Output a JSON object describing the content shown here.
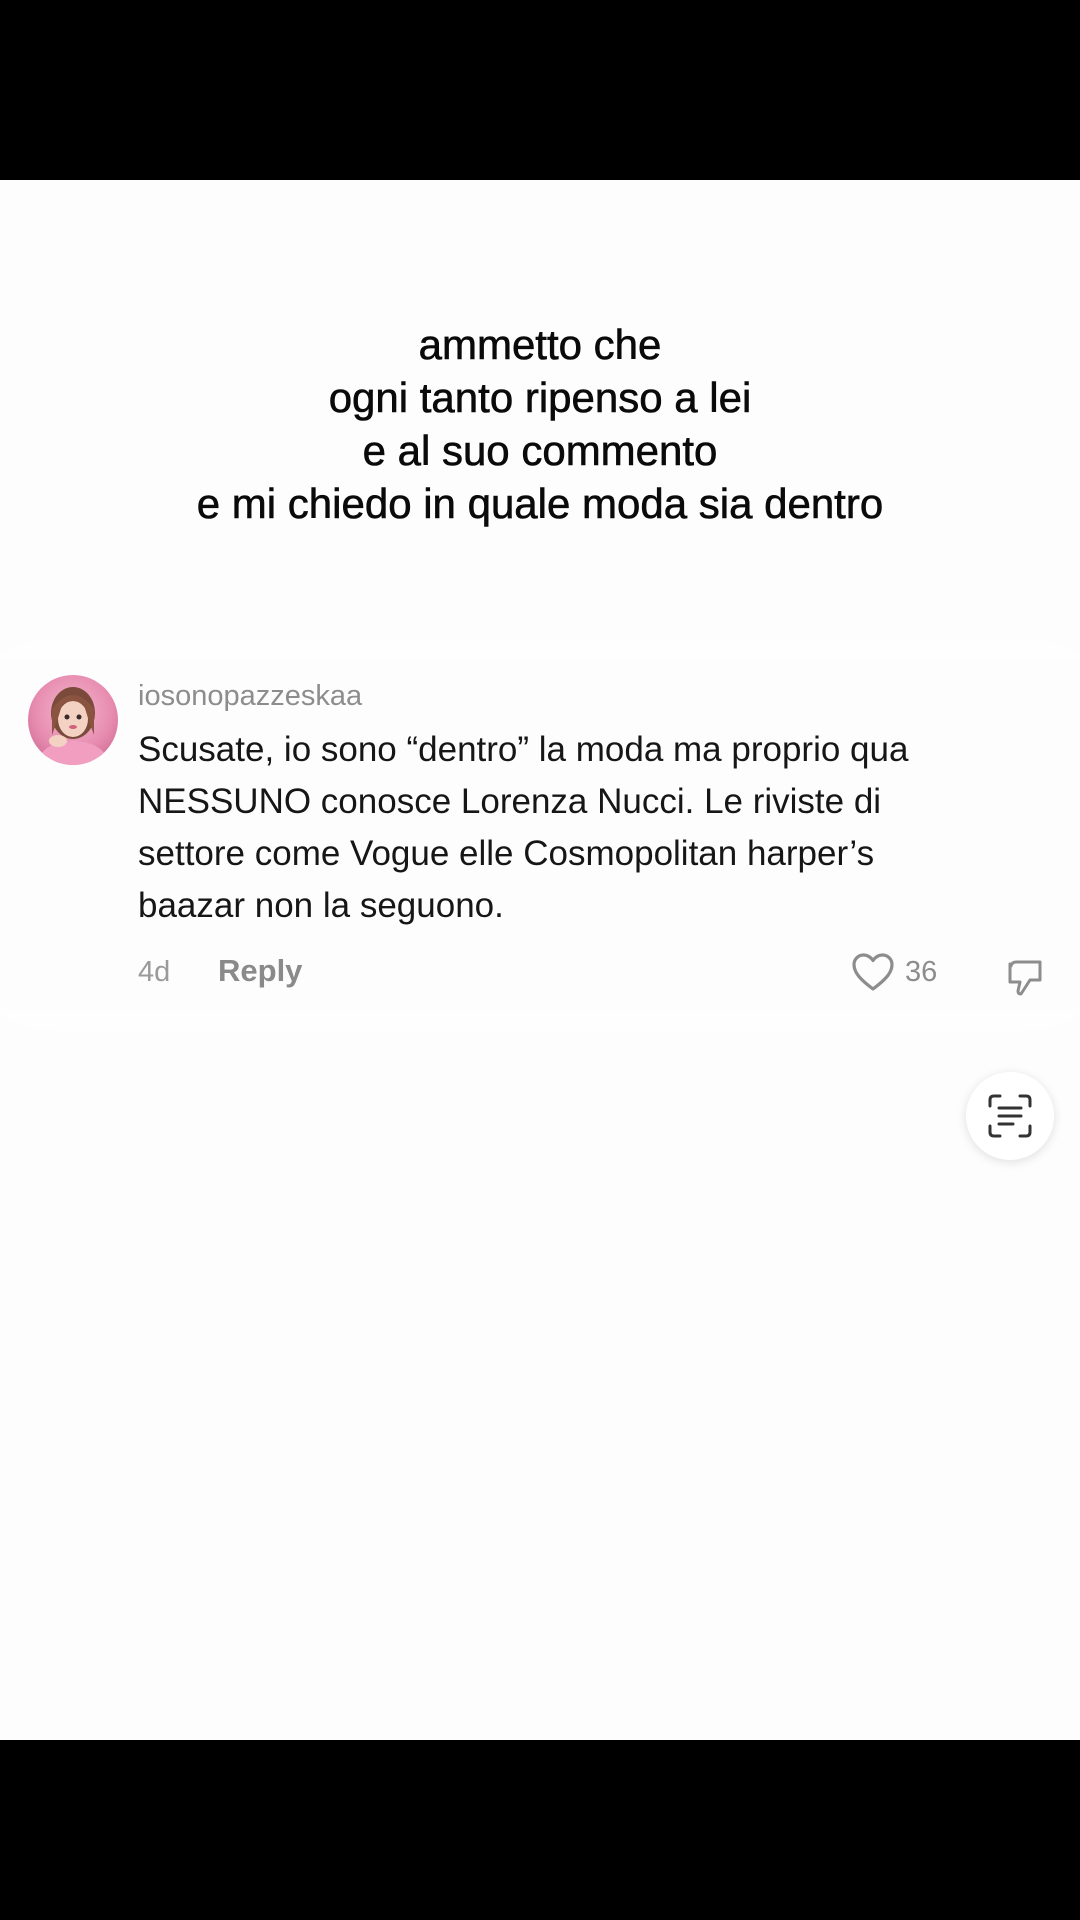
{
  "caption": {
    "lines": [
      "ammetto che",
      "ogni tanto ripenso a lei",
      "e al suo commento",
      "e mi chiedo in quale moda sia dentro"
    ]
  },
  "comment": {
    "username": "iosonopazzeskaa",
    "text_lines": [
      "Scusate, io sono “dentro” la moda ma proprio qua",
      "NESSUNO conosce Lorenza Nucci. Le riviste di",
      "settore come Vogue elle Cosmopolitan harper’s",
      "baazar non la seguono."
    ],
    "time": "4d",
    "reply_label": "Reply",
    "like_count": "36",
    "avatar_icon": "profile-photo",
    "like_icon": "heart-outline-icon",
    "dislike_icon": "thumbs-down-icon"
  },
  "overlay": {
    "scan_icon": "text-scan-icon"
  },
  "colors": {
    "background": "#fdfdfd",
    "letterbox": "#000000",
    "caption_text": "#0a0a0a",
    "comment_text": "#161616",
    "meta_text": "#8d8d8d",
    "avatar_pink": "#e78cb0"
  }
}
